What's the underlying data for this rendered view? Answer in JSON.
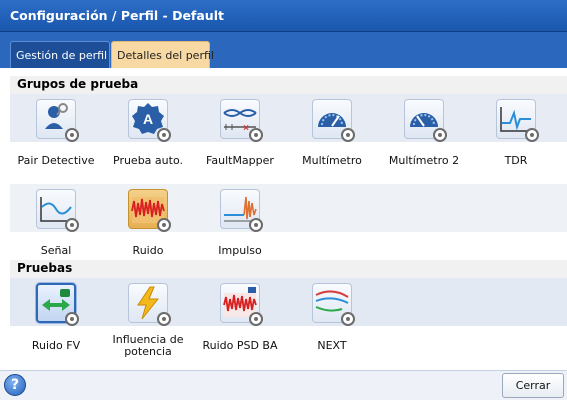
{
  "window": {
    "title": "Configuración / Perfil - Default"
  },
  "tabs": [
    {
      "label": "Gestión de perfil",
      "active": false
    },
    {
      "label": "Detalles del perfil",
      "active": true
    }
  ],
  "sections": {
    "test_groups": {
      "title": "Grupos de prueba",
      "items": [
        {
          "label": "Pair Detective",
          "icon": "pair-detective-icon"
        },
        {
          "label": "Prueba auto.",
          "icon": "auto-test-icon"
        },
        {
          "label": "FaultMapper",
          "icon": "faultmapper-icon"
        },
        {
          "label": "Multímetro",
          "icon": "multimeter-icon"
        },
        {
          "label": "Multímetro 2",
          "icon": "multimeter-2-icon"
        },
        {
          "label": "TDR",
          "icon": "tdr-icon"
        },
        {
          "label": "Señal",
          "icon": "signal-icon"
        },
        {
          "label": "Ruido",
          "icon": "noise-icon"
        },
        {
          "label": "Impulso",
          "icon": "impulse-icon"
        }
      ]
    },
    "tests": {
      "title": "Pruebas",
      "items": [
        {
          "label": "Ruido FV",
          "icon": "noise-fv-icon",
          "selected": true
        },
        {
          "label": "Influencia de potencia",
          "icon": "power-influence-icon"
        },
        {
          "label": "Ruido PSD BA",
          "icon": "noise-psd-icon"
        },
        {
          "label": "NEXT",
          "icon": "next-icon"
        }
      ]
    }
  },
  "footer": {
    "help_label": "?",
    "close_label": "Cerrar"
  },
  "colors": {
    "title_bar": "#1f5fb8",
    "active_tab": "#f8d9a3",
    "selection": "#2f68b5",
    "accent_orange": "#e6b052"
  }
}
